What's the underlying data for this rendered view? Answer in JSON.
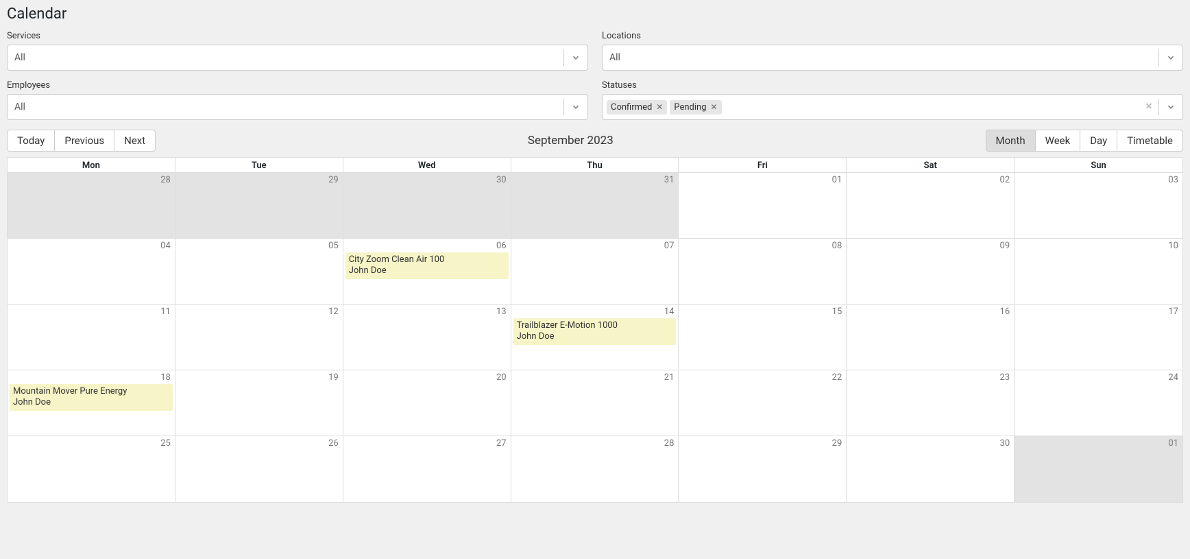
{
  "title": "Calendar",
  "filters": {
    "services": {
      "label": "Services",
      "value": "All"
    },
    "locations": {
      "label": "Locations",
      "value": "All"
    },
    "employees": {
      "label": "Employees",
      "value": "All"
    },
    "statuses": {
      "label": "Statuses",
      "tags": [
        "Confirmed",
        "Pending"
      ]
    }
  },
  "nav": {
    "today": "Today",
    "previous": "Previous",
    "next": "Next"
  },
  "current_range": "September 2023",
  "views": {
    "month": "Month",
    "week": "Week",
    "day": "Day",
    "timetable": "Timetable"
  },
  "weekdays": [
    "Mon",
    "Tue",
    "Wed",
    "Thu",
    "Fri",
    "Sat",
    "Sun"
  ],
  "weeks": [
    [
      {
        "num": "28",
        "out": true
      },
      {
        "num": "29",
        "out": true
      },
      {
        "num": "30",
        "out": true
      },
      {
        "num": "31",
        "out": true
      },
      {
        "num": "01"
      },
      {
        "num": "02"
      },
      {
        "num": "03"
      }
    ],
    [
      {
        "num": "04"
      },
      {
        "num": "05"
      },
      {
        "num": "06",
        "events": [
          {
            "title": "City Zoom Clean Air 100",
            "who": "John Doe"
          }
        ]
      },
      {
        "num": "07"
      },
      {
        "num": "08"
      },
      {
        "num": "09"
      },
      {
        "num": "10"
      }
    ],
    [
      {
        "num": "11"
      },
      {
        "num": "12"
      },
      {
        "num": "13"
      },
      {
        "num": "14",
        "events": [
          {
            "title": "Trailblazer E-Motion 1000",
            "who": "John Doe"
          }
        ]
      },
      {
        "num": "15"
      },
      {
        "num": "16"
      },
      {
        "num": "17"
      }
    ],
    [
      {
        "num": "18",
        "events": [
          {
            "title": "Mountain Mover Pure Energy",
            "who": "John Doe"
          }
        ]
      },
      {
        "num": "19"
      },
      {
        "num": "20"
      },
      {
        "num": "21"
      },
      {
        "num": "22"
      },
      {
        "num": "23"
      },
      {
        "num": "24"
      }
    ],
    [
      {
        "num": "25"
      },
      {
        "num": "26"
      },
      {
        "num": "27"
      },
      {
        "num": "28"
      },
      {
        "num": "29"
      },
      {
        "num": "30"
      },
      {
        "num": "01",
        "out": true
      }
    ]
  ]
}
